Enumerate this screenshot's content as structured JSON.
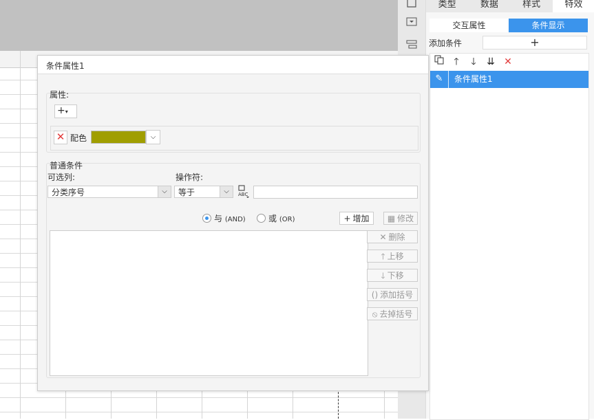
{
  "side_tools": [
    "frame-icon",
    "dropdown-box-icon",
    "align-icon"
  ],
  "tabs": {
    "items": [
      "类型",
      "数据",
      "样式",
      "特效"
    ],
    "active": "特效"
  },
  "subtabs": {
    "items": [
      "交互属性",
      "条件显示"
    ],
    "active": "条件显示"
  },
  "add_condition": {
    "label": "添加条件",
    "button": "+"
  },
  "list_tools": [
    "copy-icon",
    "move-up-icon",
    "move-down-icon",
    "sort-icon",
    "delete-icon"
  ],
  "condition_list": [
    {
      "label": "条件属性1"
    }
  ],
  "dialog": {
    "title": "条件属性1",
    "attribute_group_label": "属性:",
    "add_attribute_button": "+",
    "color_row": {
      "label": "配色",
      "color": "#a09e00"
    },
    "general_group_label": "普通条件",
    "column_label": "可选列:",
    "column_value": "分类序号",
    "operator_label": "操作符:",
    "operator_value": "等于",
    "value_input": "",
    "radio_and": {
      "label": "与",
      "suffix": "(AND)",
      "checked": true
    },
    "radio_or": {
      "label": "或",
      "suffix": "(OR)",
      "checked": false
    },
    "buttons": {
      "add": "增加",
      "modify": "修改",
      "delete": "删除",
      "move_up": "上移",
      "move_down": "下移",
      "add_bracket": "添加括号",
      "remove_bracket": "去掉括号"
    }
  },
  "colors": {
    "accent": "#3b94ec",
    "danger": "#e23b3b"
  }
}
